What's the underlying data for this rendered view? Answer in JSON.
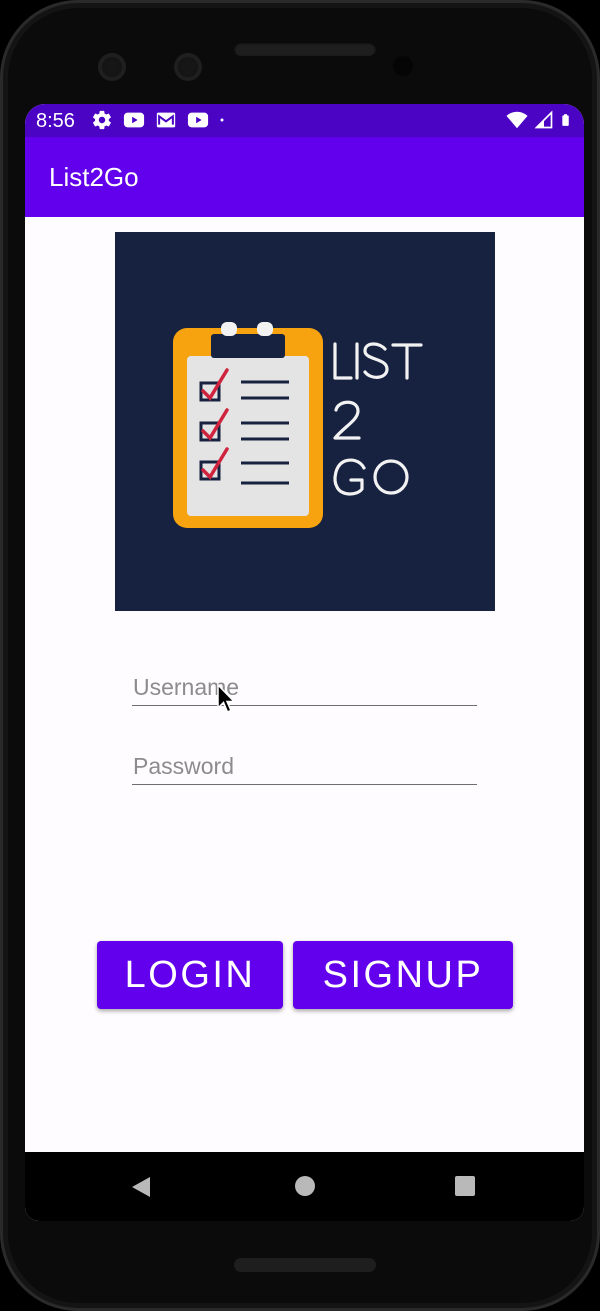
{
  "status_bar": {
    "time": "8:56",
    "icons_left": [
      "settings-icon",
      "youtube-icon",
      "gmail-icon",
      "youtube-icon",
      "dot-icon"
    ],
    "icons_right": [
      "wifi-icon",
      "signal-icon",
      "battery-icon"
    ],
    "background": "#4b03c4"
  },
  "app_bar": {
    "title": "List2Go",
    "background": "#6200ee"
  },
  "logo": {
    "text_lines": [
      "LIST",
      "2",
      "GO"
    ],
    "background": "#172240",
    "clipboard_color": "#f7a20f",
    "check_color": "#d0233d"
  },
  "form": {
    "username_placeholder": "Username",
    "password_placeholder": "Password"
  },
  "buttons": {
    "login_label": "LOGIN",
    "signup_label": "SIGNUP"
  },
  "nav_bar": {
    "icons": [
      "back-icon",
      "home-icon",
      "recents-icon"
    ]
  }
}
